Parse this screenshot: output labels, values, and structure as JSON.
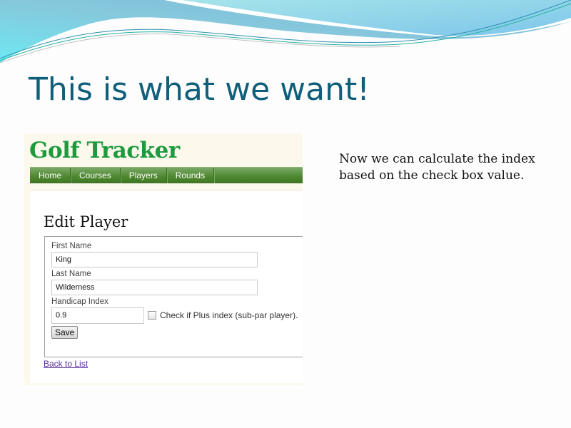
{
  "slide": {
    "title": "This is what we want!",
    "note": "Now we can calculate the index based on the check box value."
  },
  "app": {
    "logo": "Golf Tracker",
    "nav": [
      "Home",
      "Courses",
      "Players",
      "Rounds"
    ],
    "page_heading": "Edit Player",
    "form": {
      "first_name_label": "First Name",
      "first_name_value": "King",
      "last_name_label": "Last Name",
      "last_name_value": "Wilderness",
      "handicap_label": "Handicap Index",
      "handicap_value": "0.9",
      "plus_checkbox_label": "Check if Plus index (sub-par player).",
      "plus_checked": false,
      "save_label": "Save"
    },
    "back_link": "Back to List"
  }
}
